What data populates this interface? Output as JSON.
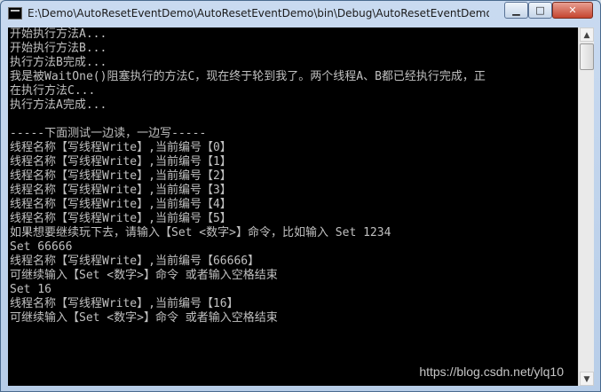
{
  "window": {
    "title": "E:\\Demo\\AutoResetEventDemo\\AutoResetEventDemo\\bin\\Debug\\AutoResetEventDemo.e...",
    "controls": {
      "minimize": "▁",
      "maximize": "□",
      "close": "✕"
    }
  },
  "console": {
    "background": "#000000",
    "text_color": "#c0c0c0",
    "lines": [
      "开始执行方法A...",
      "开始执行方法B...",
      "执行方法B完成...",
      "我是被WaitOne()阻塞执行的方法C，现在终于轮到我了。两个线程A、B都已经执行完成，正",
      "在执行方法C...",
      "执行方法A完成...",
      "",
      "-----下面测试一边读，一边写-----",
      "线程名称【写线程Write】,当前编号【0】",
      "线程名称【写线程Write】,当前编号【1】",
      "线程名称【写线程Write】,当前编号【2】",
      "线程名称【写线程Write】,当前编号【3】",
      "线程名称【写线程Write】,当前编号【4】",
      "线程名称【写线程Write】,当前编号【5】",
      "如果想要继续玩下去，请输入【Set <数字>】命令，比如输入 Set 1234",
      "Set 66666",
      "线程名称【写线程Write】,当前编号【66666】",
      "可继续输入【Set <数字>】命令 或者输入空格结束",
      "Set 16",
      "线程名称【写线程Write】,当前编号【16】",
      "可继续输入【Set <数字>】命令 或者输入空格结束"
    ]
  },
  "scrollbar": {
    "up": "▲",
    "down": "▼",
    "position": 0.0
  },
  "watermark": "https://blog.csdn.net/ylq10"
}
